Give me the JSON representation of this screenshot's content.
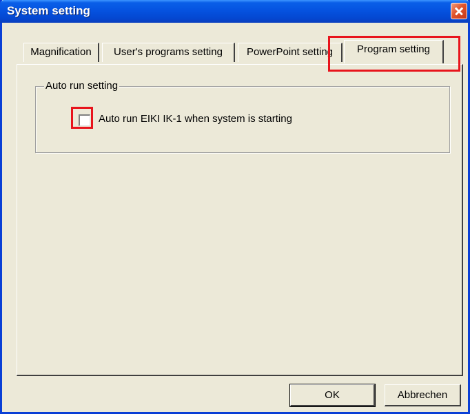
{
  "window": {
    "title": "System setting"
  },
  "tabs": [
    {
      "label": "Magnification",
      "active": false
    },
    {
      "label": "User's programs setting",
      "active": false
    },
    {
      "label": "PowerPoint setting",
      "active": false
    },
    {
      "label": "Program setting",
      "active": true
    }
  ],
  "autorun": {
    "group_title": "Auto run setting",
    "checkbox_label": "Auto run EIKI IK-1 when system is starting",
    "checked": false
  },
  "buttons": {
    "ok": "OK",
    "cancel": "Abbrechen"
  },
  "colors": {
    "highlight": "#e8141c",
    "titlebar": "#0553e0",
    "dialog_bg": "#ece9d8"
  }
}
